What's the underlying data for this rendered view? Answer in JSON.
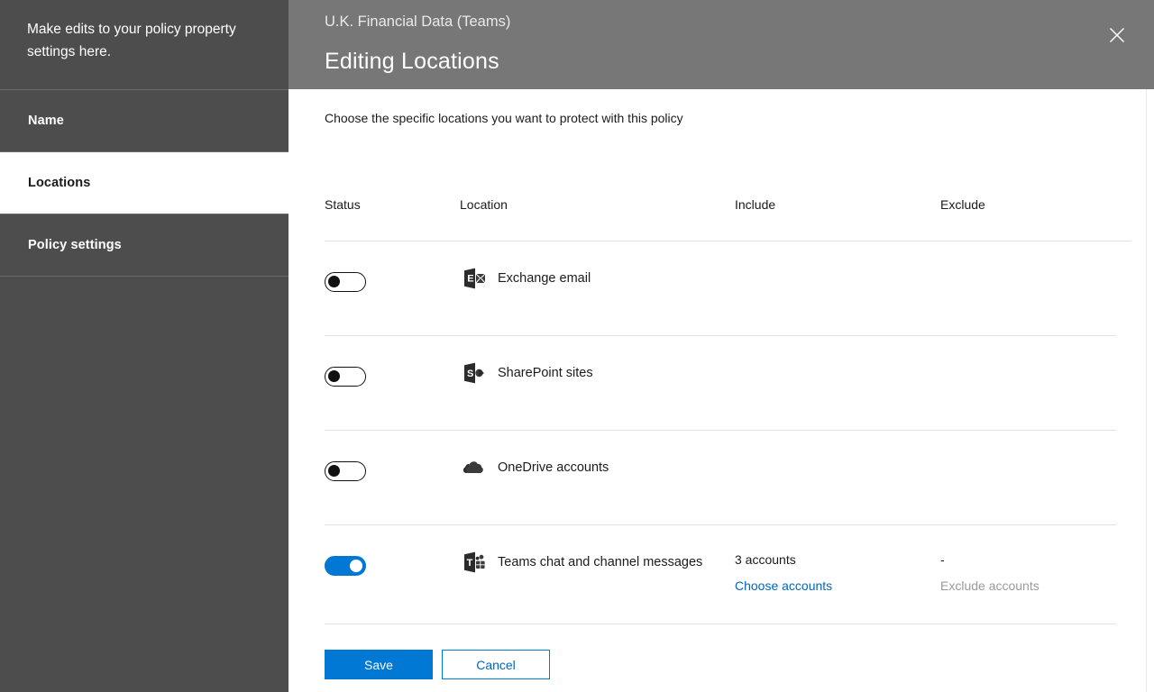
{
  "sidebar": {
    "intro_text": "Make edits to your policy property settings here.",
    "items": [
      {
        "label": "Name",
        "active": false
      },
      {
        "label": "Locations",
        "active": true
      },
      {
        "label": "Policy settings",
        "active": false
      }
    ]
  },
  "header": {
    "subtitle": "U.K. Financial Data (Teams)",
    "title": "Editing Locations",
    "close_icon": "close-icon"
  },
  "main": {
    "description": "Choose the specific locations you want to protect with this policy",
    "columns": {
      "status": "Status",
      "location": "Location",
      "include": "Include",
      "exclude": "Exclude"
    },
    "rows": [
      {
        "icon": "exchange-icon",
        "location": "Exchange email",
        "enabled": false,
        "include_value": "",
        "include_link": "",
        "exclude_value": "",
        "exclude_link": ""
      },
      {
        "icon": "sharepoint-icon",
        "location": "SharePoint sites",
        "enabled": false,
        "include_value": "",
        "include_link": "",
        "exclude_value": "",
        "exclude_link": ""
      },
      {
        "icon": "onedrive-icon",
        "location": "OneDrive accounts",
        "enabled": false,
        "include_value": "",
        "include_link": "",
        "exclude_value": "",
        "exclude_link": ""
      },
      {
        "icon": "teams-icon",
        "location": "Teams chat and channel messages",
        "enabled": true,
        "include_value": "3 accounts",
        "include_link": "Choose accounts",
        "exclude_value": "-",
        "exclude_link": "Exclude accounts"
      }
    ],
    "save_label": "Save",
    "cancel_label": "Cancel"
  },
  "colors": {
    "accent": "#0078d4",
    "link": "#0066bf",
    "sidebar_bg": "#4d4d4d",
    "header_bg": "#777777",
    "disabled_text": "#9a9a9a"
  }
}
